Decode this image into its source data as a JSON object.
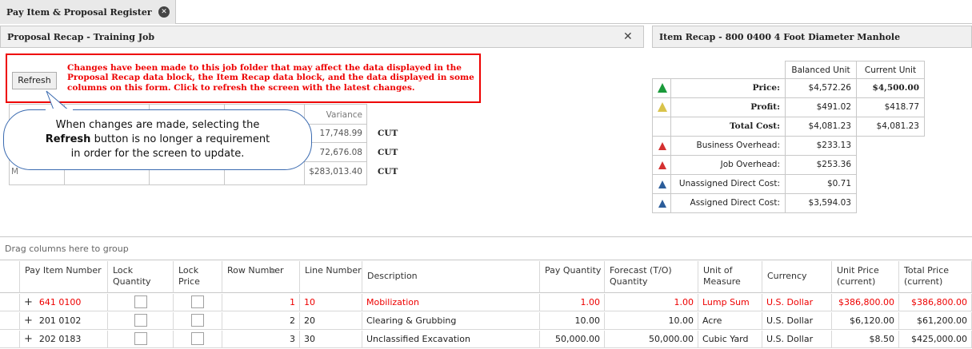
{
  "tab": {
    "title": "Pay Item & Proposal Register",
    "close_glyph": "✕"
  },
  "proposal_recap": {
    "title": "Proposal Recap - Training Job",
    "close_glyph": "✕"
  },
  "item_recap": {
    "title": "Item Recap - 800 0400 4 Foot Diameter Manhole",
    "headers": {
      "balanced": "Balanced Unit",
      "current": "Current Unit"
    },
    "rows": [
      {
        "label": "Price:",
        "balanced": "$4,572.26",
        "current": "$4,500.00",
        "icon": "green-triangle-icon"
      },
      {
        "label": "Profit:",
        "balanced": "$491.02",
        "current": "$418.77",
        "icon": "yellow-triangle-icon"
      },
      {
        "label": "Total Cost:",
        "balanced": "$4,081.23",
        "current": "$4,081.23",
        "icon": ""
      },
      {
        "label": "Business Overhead:",
        "balanced": "$233.13",
        "icon": "red-triangle-icon"
      },
      {
        "label": "Job Overhead:",
        "balanced": "$253.36",
        "icon": "red-triangle-icon"
      },
      {
        "label": "Unassigned Direct Cost:",
        "balanced": "$0.71",
        "icon": "blue-triangle-icon"
      },
      {
        "label": "Assigned Direct Cost:",
        "balanced": "$3,594.03",
        "icon": "blue-triangle-icon"
      }
    ]
  },
  "warning": {
    "refresh_label": "Refresh",
    "message": "Changes have been made to this job folder that may affect the data displayed in the Proposal Recap data block, the Item Recap data block, and the data displayed in some columns on this form. Click to refresh the screen with the latest changes."
  },
  "recap_grid": {
    "variance_header": "Variance",
    "values": [
      "17,748.99",
      "72,676.08",
      "$283,013.40"
    ],
    "flags": [
      "CUT",
      "CUT",
      "CUT"
    ],
    "partial_label": "M"
  },
  "callout": {
    "line1": "When changes are made, selecting the",
    "bold": "Refresh",
    "line2": " button is no longer a requirement",
    "line3": "in order for the screen to update."
  },
  "grid": {
    "group_hint": "Drag columns here to group",
    "columns": [
      "Pay Item Number",
      "Lock Quantity",
      "Lock Price",
      "Row Number",
      "Line Number",
      "Description",
      "Pay Quantity",
      "Forecast (T/O) Quantity",
      "Unit of Measure",
      "Currency",
      "Unit Price (current)",
      "Total Price (current)"
    ],
    "rows": [
      {
        "expand": "+",
        "pay_item": "641 0100",
        "row": "1",
        "line": "10",
        "desc": "Mobilization",
        "pay_qty": "1.00",
        "fc_qty": "1.00",
        "uom": "Lump Sum",
        "currency": "U.S. Dollar",
        "unit_price": "$386,800.00",
        "total": "$386,800.00"
      },
      {
        "expand": "+",
        "pay_item": "201 0102",
        "row": "2",
        "line": "20",
        "desc": "Clearing & Grubbing",
        "pay_qty": "10.00",
        "fc_qty": "10.00",
        "uom": "Acre",
        "currency": "U.S. Dollar",
        "unit_price": "$6,120.00",
        "total": "$61,200.00"
      },
      {
        "expand": "+",
        "pay_item": "202 0183",
        "row": "3",
        "line": "30",
        "desc": "Unclassified Excavation",
        "pay_qty": "50,000.00",
        "fc_qty": "50,000.00",
        "uom": "Cubic Yard",
        "currency": "U.S. Dollar",
        "unit_price": "$8.50",
        "total": "$425,000.00"
      }
    ]
  },
  "colors": {
    "warning": "#e00000",
    "header_bg": "#f0f0f0",
    "callout_border": "#3a6ab0"
  }
}
